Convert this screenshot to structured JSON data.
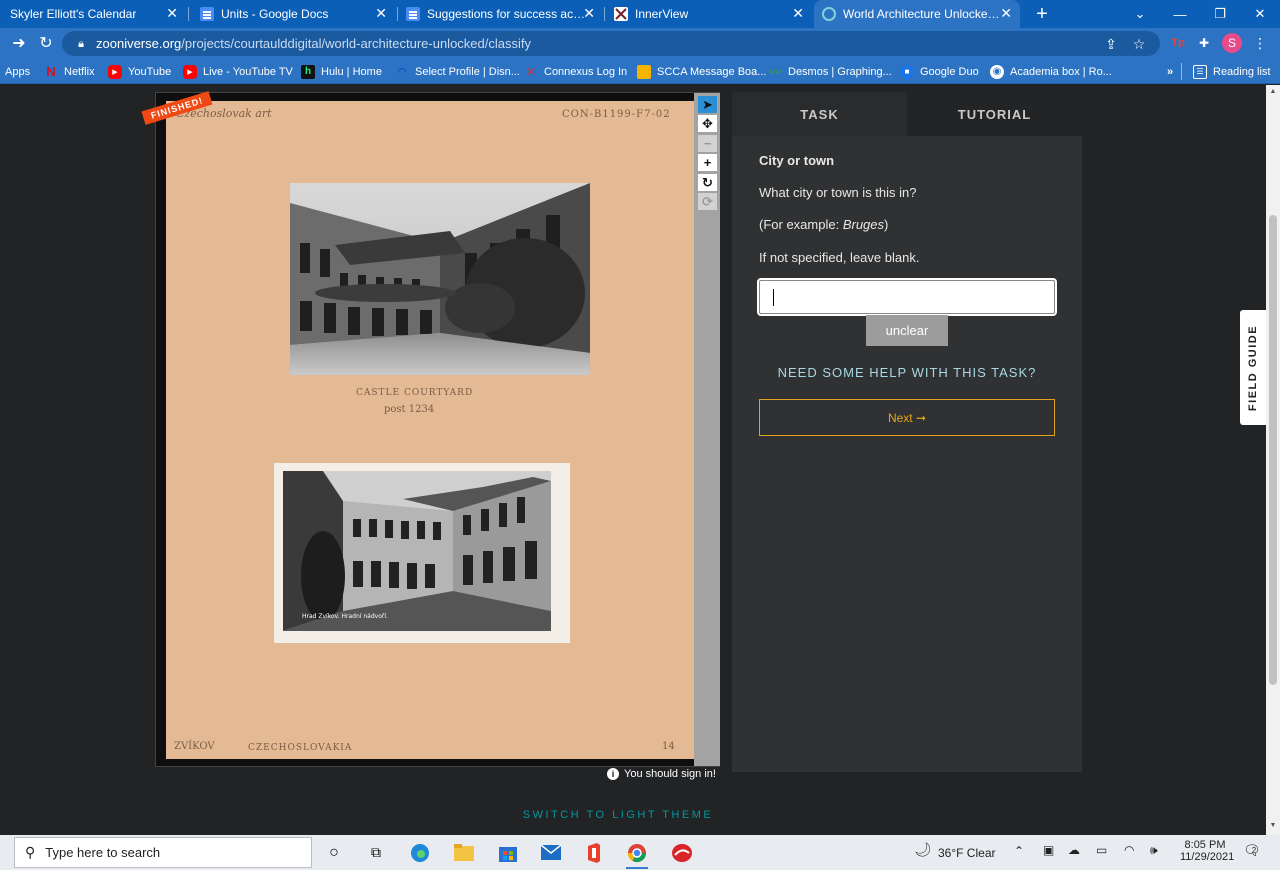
{
  "browser": {
    "tabs": [
      {
        "title": "Skyler Elliott's Calendar",
        "icon": "calendar-icon",
        "color": "#4285f4"
      },
      {
        "title": "Units - Google Docs",
        "icon": "google-docs-icon",
        "color": "#4285f4"
      },
      {
        "title": "Suggestions for success activity",
        "icon": "google-docs-icon",
        "color": "#4285f4"
      },
      {
        "title": "InnerView",
        "icon": "innerview-icon",
        "color": "#7a1f2b"
      },
      {
        "title": "World Architecture Unlocked » C",
        "icon": "zooniverse-icon",
        "color": "#00979d",
        "active": true
      }
    ],
    "address": {
      "domain": "zooniverse.org",
      "path": "/projects/courtaulddigital/world-architecture-unlocked/classify"
    },
    "extension_avatar": "S",
    "bookmarks": [
      {
        "label": "Apps",
        "icon": "apps-grid-icon"
      },
      {
        "label": "Netflix",
        "icon": "netflix-icon",
        "color": "#e50914"
      },
      {
        "label": "YouTube",
        "icon": "youtube-icon",
        "color": "#ff0000"
      },
      {
        "label": "Live - YouTube TV",
        "icon": "youtube-tv-icon",
        "color": "#ff0000"
      },
      {
        "label": "Hulu | Home",
        "icon": "hulu-icon",
        "color": "#1ce783"
      },
      {
        "label": "Select Profile | Disn...",
        "icon": "disney-icon",
        "color": "#113ccf"
      },
      {
        "label": "Connexus Log In",
        "icon": "connexus-icon",
        "color": "#d0312d"
      },
      {
        "label": "SCCA Message Boa...",
        "icon": "scca-icon",
        "color": "#f6b400"
      },
      {
        "label": "Desmos | Graphing...",
        "icon": "desmos-icon",
        "color": "#2f9e44"
      },
      {
        "label": "Google Duo",
        "icon": "google-duo-icon",
        "color": "#1a73e8"
      },
      {
        "label": "Academia box | Ro...",
        "icon": "academia-icon",
        "color": "#ffffff"
      }
    ],
    "bookmarks_overflow": "»",
    "reading_list": "Reading list"
  },
  "subject": {
    "badge": "FINISHED!",
    "top_left_note": "Czechoslovak art",
    "top_right_note": "CON-B1199-F7-02",
    "upper_caption_line1": "CASTLE  COURTYARD",
    "upper_caption_line2": "post 1234",
    "lower_photo_caption": "Hrad Zvíkov. Hradní nádvoří.",
    "bottom_left_note": "ZVÍKOV",
    "bottom_mid_note": "CZECHOSLOVAKIA",
    "bottom_right_note": "14"
  },
  "viewer_tools": [
    {
      "name": "annotate",
      "icon": "pointer-arrow-icon",
      "glyph": "➤",
      "state": "active"
    },
    {
      "name": "move",
      "icon": "move-arrows-icon",
      "glyph": "✥",
      "state": "normal"
    },
    {
      "name": "zoom-out",
      "icon": "minus-icon",
      "glyph": "−",
      "state": "disabled"
    },
    {
      "name": "zoom-in",
      "icon": "plus-icon",
      "glyph": "+",
      "state": "normal"
    },
    {
      "name": "rotate",
      "icon": "rotate-icon",
      "glyph": "↻",
      "state": "normal"
    },
    {
      "name": "reset",
      "icon": "reset-icon",
      "glyph": "⟳",
      "state": "disabled"
    }
  ],
  "sign_in_notice": "You should sign in!",
  "theme_toggle": "SWITCH TO LIGHT THEME",
  "task_panel": {
    "tabs": {
      "task": "TASK",
      "tutorial": "TUTORIAL"
    },
    "title": "City or town",
    "question": "What city or town is this in?",
    "example_prefix": "(For example: ",
    "example_value": "Bruges",
    "example_suffix": ")",
    "hint": "If not specified, leave blank.",
    "answer_value": "",
    "unclear_label": "unclear",
    "help_label": "NEED SOME HELP WITH THIS TASK?",
    "next_label": "Next ➞"
  },
  "field_guide": "FIELD GUIDE",
  "taskbar": {
    "search_placeholder": "Type here to search",
    "weather": "36°F  Clear",
    "time": "8:05 PM",
    "date": "11/29/2021",
    "notifications": "2"
  },
  "colors": {
    "chrome_blue": "#2d73c4",
    "zooniverse_teal": "#00979d",
    "next_gold": "#e6a51b",
    "finished_orange": "#ef4a16"
  }
}
